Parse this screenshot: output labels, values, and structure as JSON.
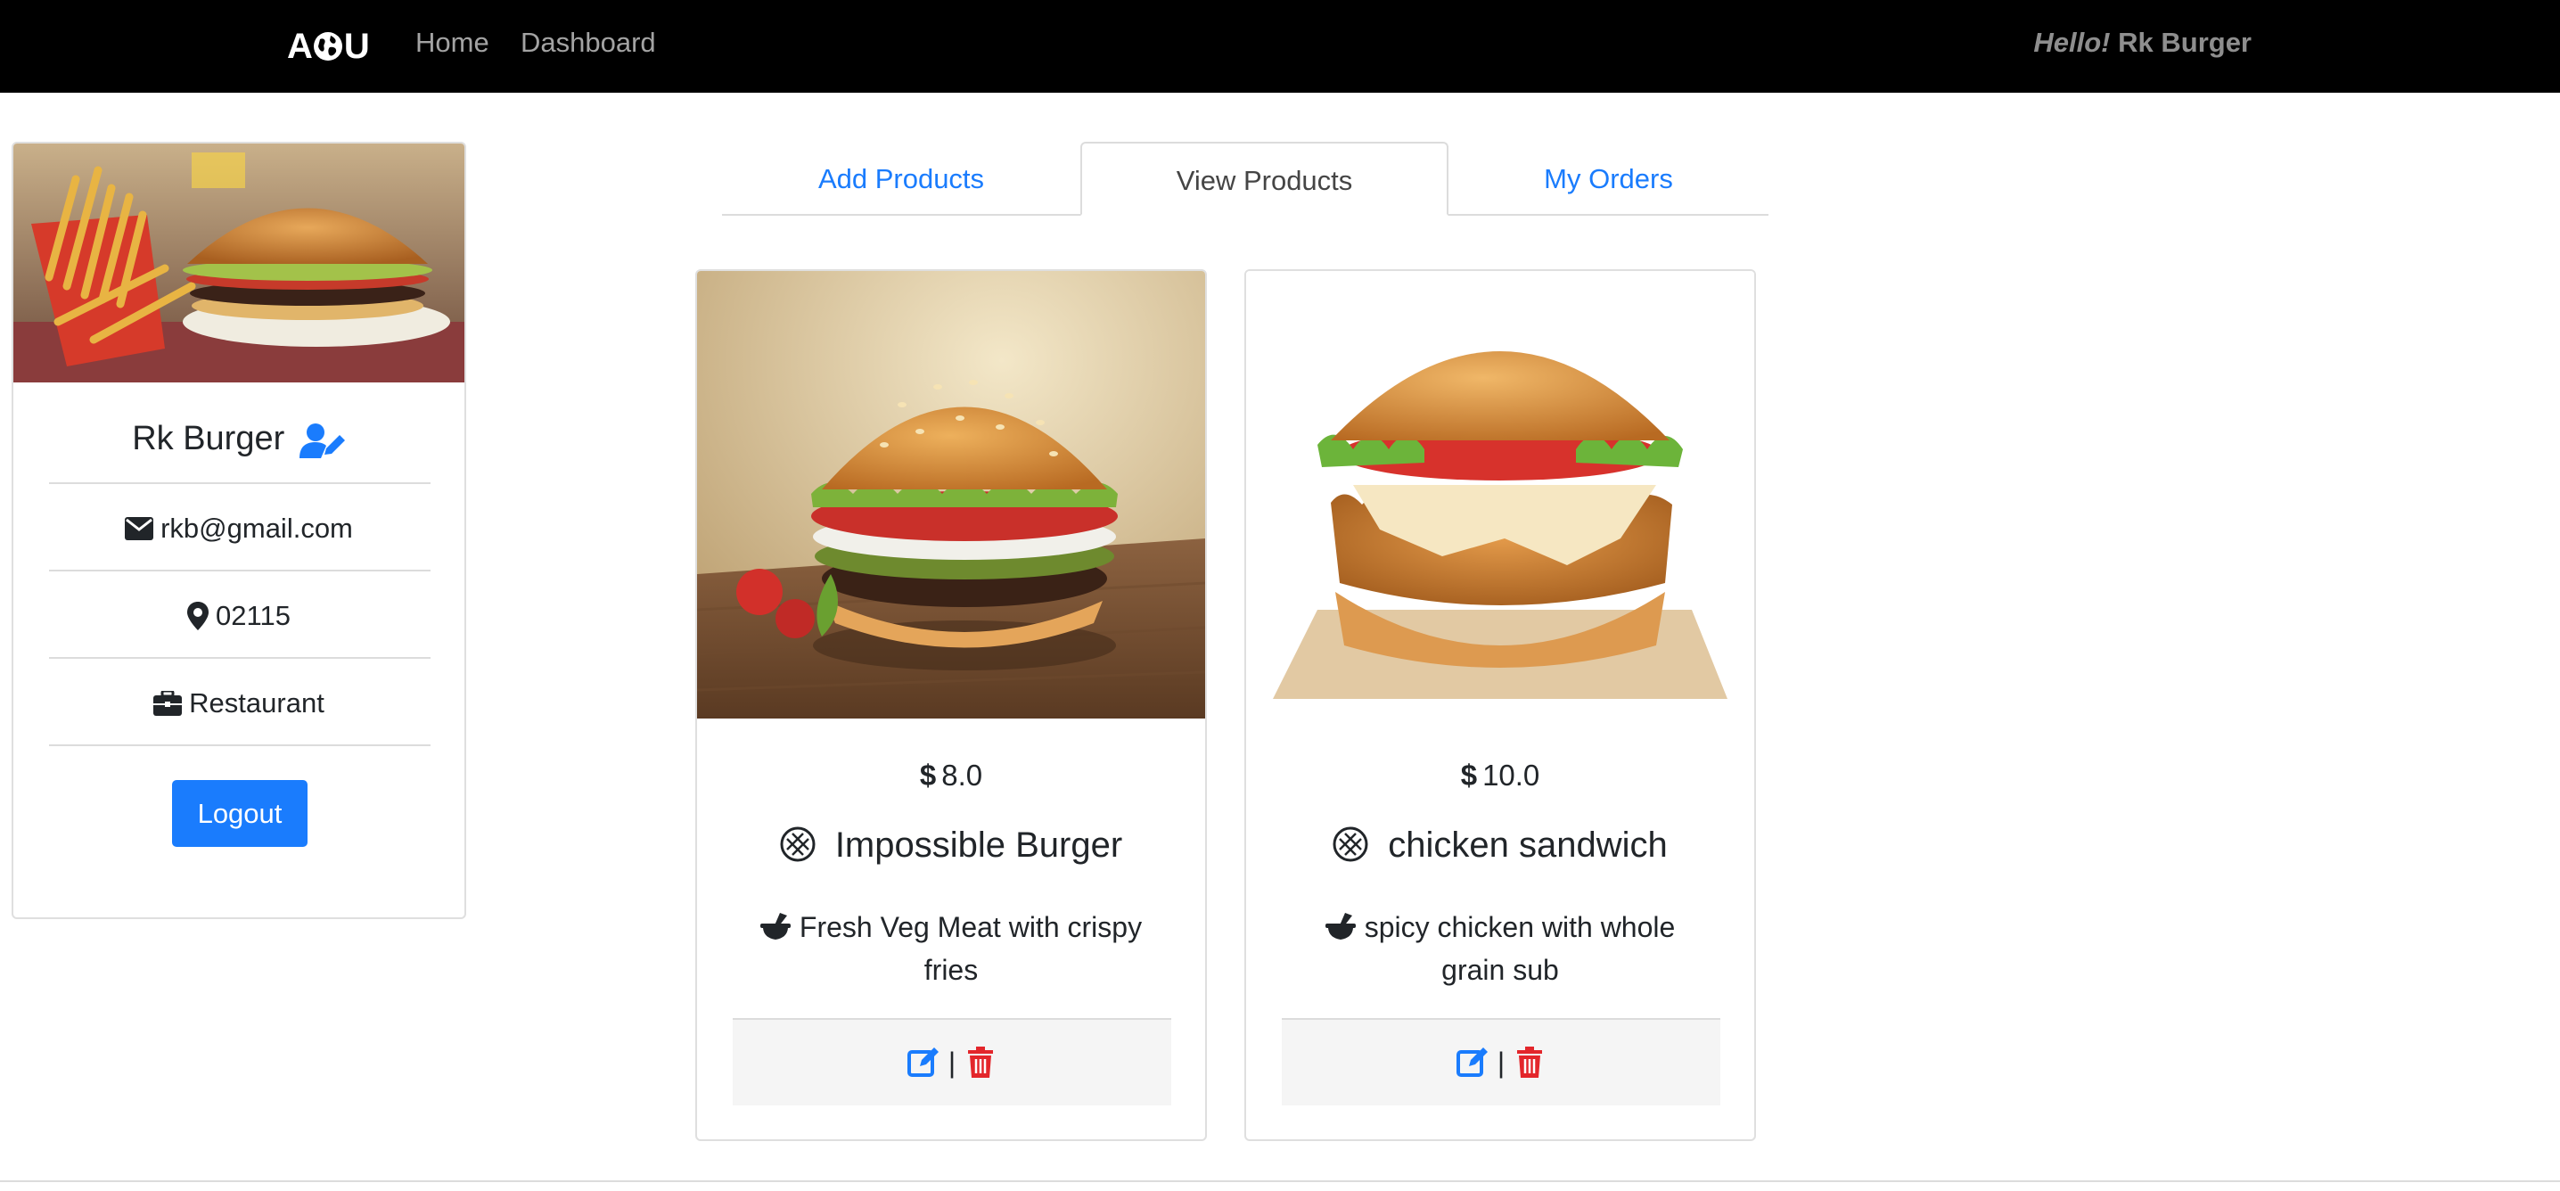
{
  "navbar": {
    "brand_left": "A",
    "brand_right": "U",
    "links": [
      {
        "label": "Home"
      },
      {
        "label": "Dashboard"
      }
    ],
    "greeting_prefix": "Hello!",
    "greeting_name": "Rk Burger"
  },
  "profile": {
    "name": "Rk Burger",
    "email": "rkb@gmail.com",
    "zip": "02115",
    "type": "Restaurant",
    "logout_label": "Logout"
  },
  "tabs": [
    {
      "label": "Add Products",
      "active": false
    },
    {
      "label": "View Products",
      "active": true
    },
    {
      "label": "My Orders",
      "active": false
    }
  ],
  "products": [
    {
      "price": "8.0",
      "name": "Impossible Burger",
      "description": "Fresh Veg Meat with crispy fries"
    },
    {
      "price": "10.0",
      "name": "chicken sandwich",
      "description": "spicy chicken with whole grain sub"
    }
  ],
  "footer_separator": "|",
  "colors": {
    "navbar_bg": "#000000",
    "accent_blue": "#1a7cfd",
    "delete_red": "#e3262b",
    "nav_text": "#a3a3a3"
  },
  "icons": {
    "user_edit": "user-edit-icon",
    "email": "envelope-icon",
    "location": "map-marker-icon",
    "business": "briefcase-icon",
    "dollar": "dollar-icon",
    "food": "cookie-icon",
    "description": "mortar-pestle-icon",
    "edit": "edit-icon",
    "delete": "trash-icon"
  }
}
